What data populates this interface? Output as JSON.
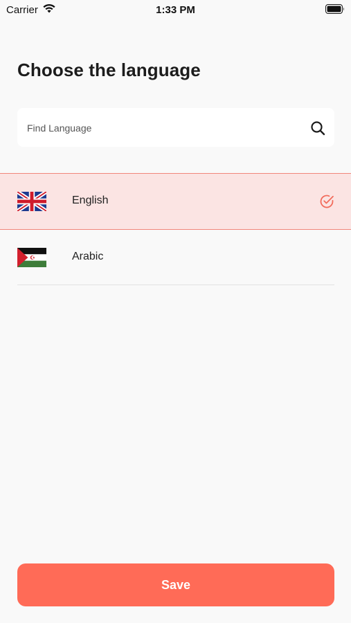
{
  "status_bar": {
    "carrier": "Carrier",
    "time": "1:33 PM",
    "wifi_icon": "wifi-icon",
    "battery_icon": "battery-icon"
  },
  "page": {
    "title": "Choose the language"
  },
  "search": {
    "placeholder": "Find Language",
    "value": "",
    "icon": "search-icon"
  },
  "languages": [
    {
      "name": "English",
      "flag": "uk-flag-icon",
      "selected": true
    },
    {
      "name": "Arabic",
      "flag": "arabic-flag-icon",
      "selected": false
    }
  ],
  "save_button": {
    "label": "Save"
  },
  "colors": {
    "accent": "#ff6b57",
    "selected_row_bg": "#fbe4e3",
    "selected_row_border": "#f1857a",
    "background": "#f9f9f9"
  }
}
